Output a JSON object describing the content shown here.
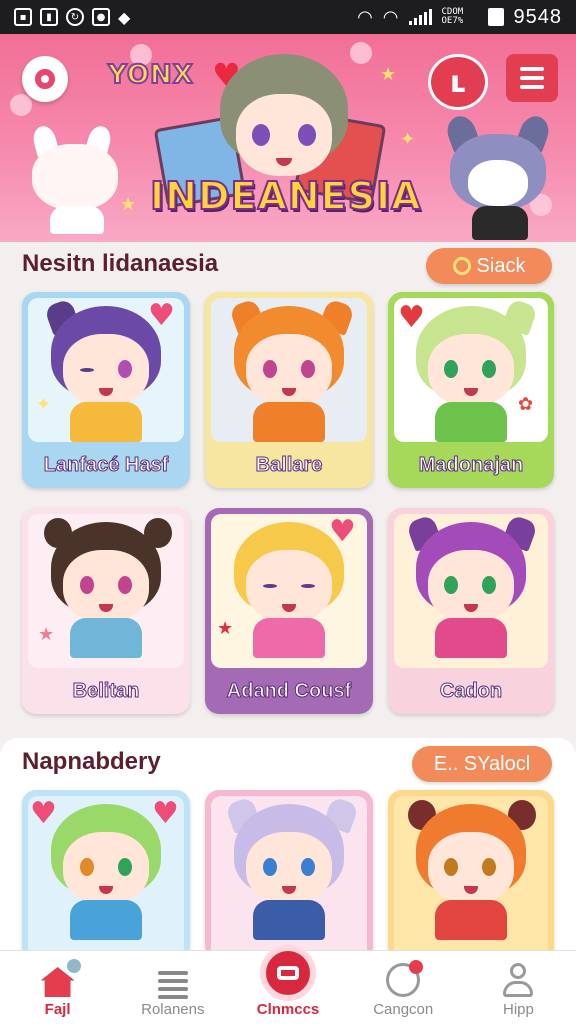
{
  "status_bar": {
    "carrier": "CDOM OE7%",
    "time": "9548"
  },
  "banner": {
    "brand": "YONX",
    "title": "INDEANESIA"
  },
  "section1": {
    "title": "Nesitn lidanaesia",
    "button": "Siack",
    "cards": [
      {
        "label": "Lanfacé Hasf"
      },
      {
        "label": "Ballare"
      },
      {
        "label": "Madonajan"
      },
      {
        "label": "Belitan"
      },
      {
        "label": "Adand Cousf"
      },
      {
        "label": "Cadon"
      }
    ]
  },
  "section2": {
    "title": "Napnabdery",
    "button": "E.. SYalocl"
  },
  "bottom_nav": [
    {
      "label": "Fajl",
      "icon": "home-icon",
      "active": true
    },
    {
      "label": "Rolanens",
      "icon": "list-icon",
      "active": false
    },
    {
      "label": "Clnmccs",
      "icon": "record-icon",
      "active": true
    },
    {
      "label": "Cangcon",
      "icon": "smiley-icon",
      "active": false
    },
    {
      "label": "Hipp",
      "icon": "person-icon",
      "active": false
    }
  ],
  "colors": {
    "accent": "#e33d52",
    "banner": "#f26f96",
    "pill": "#f28a5a",
    "title": "#5b1f2e"
  }
}
